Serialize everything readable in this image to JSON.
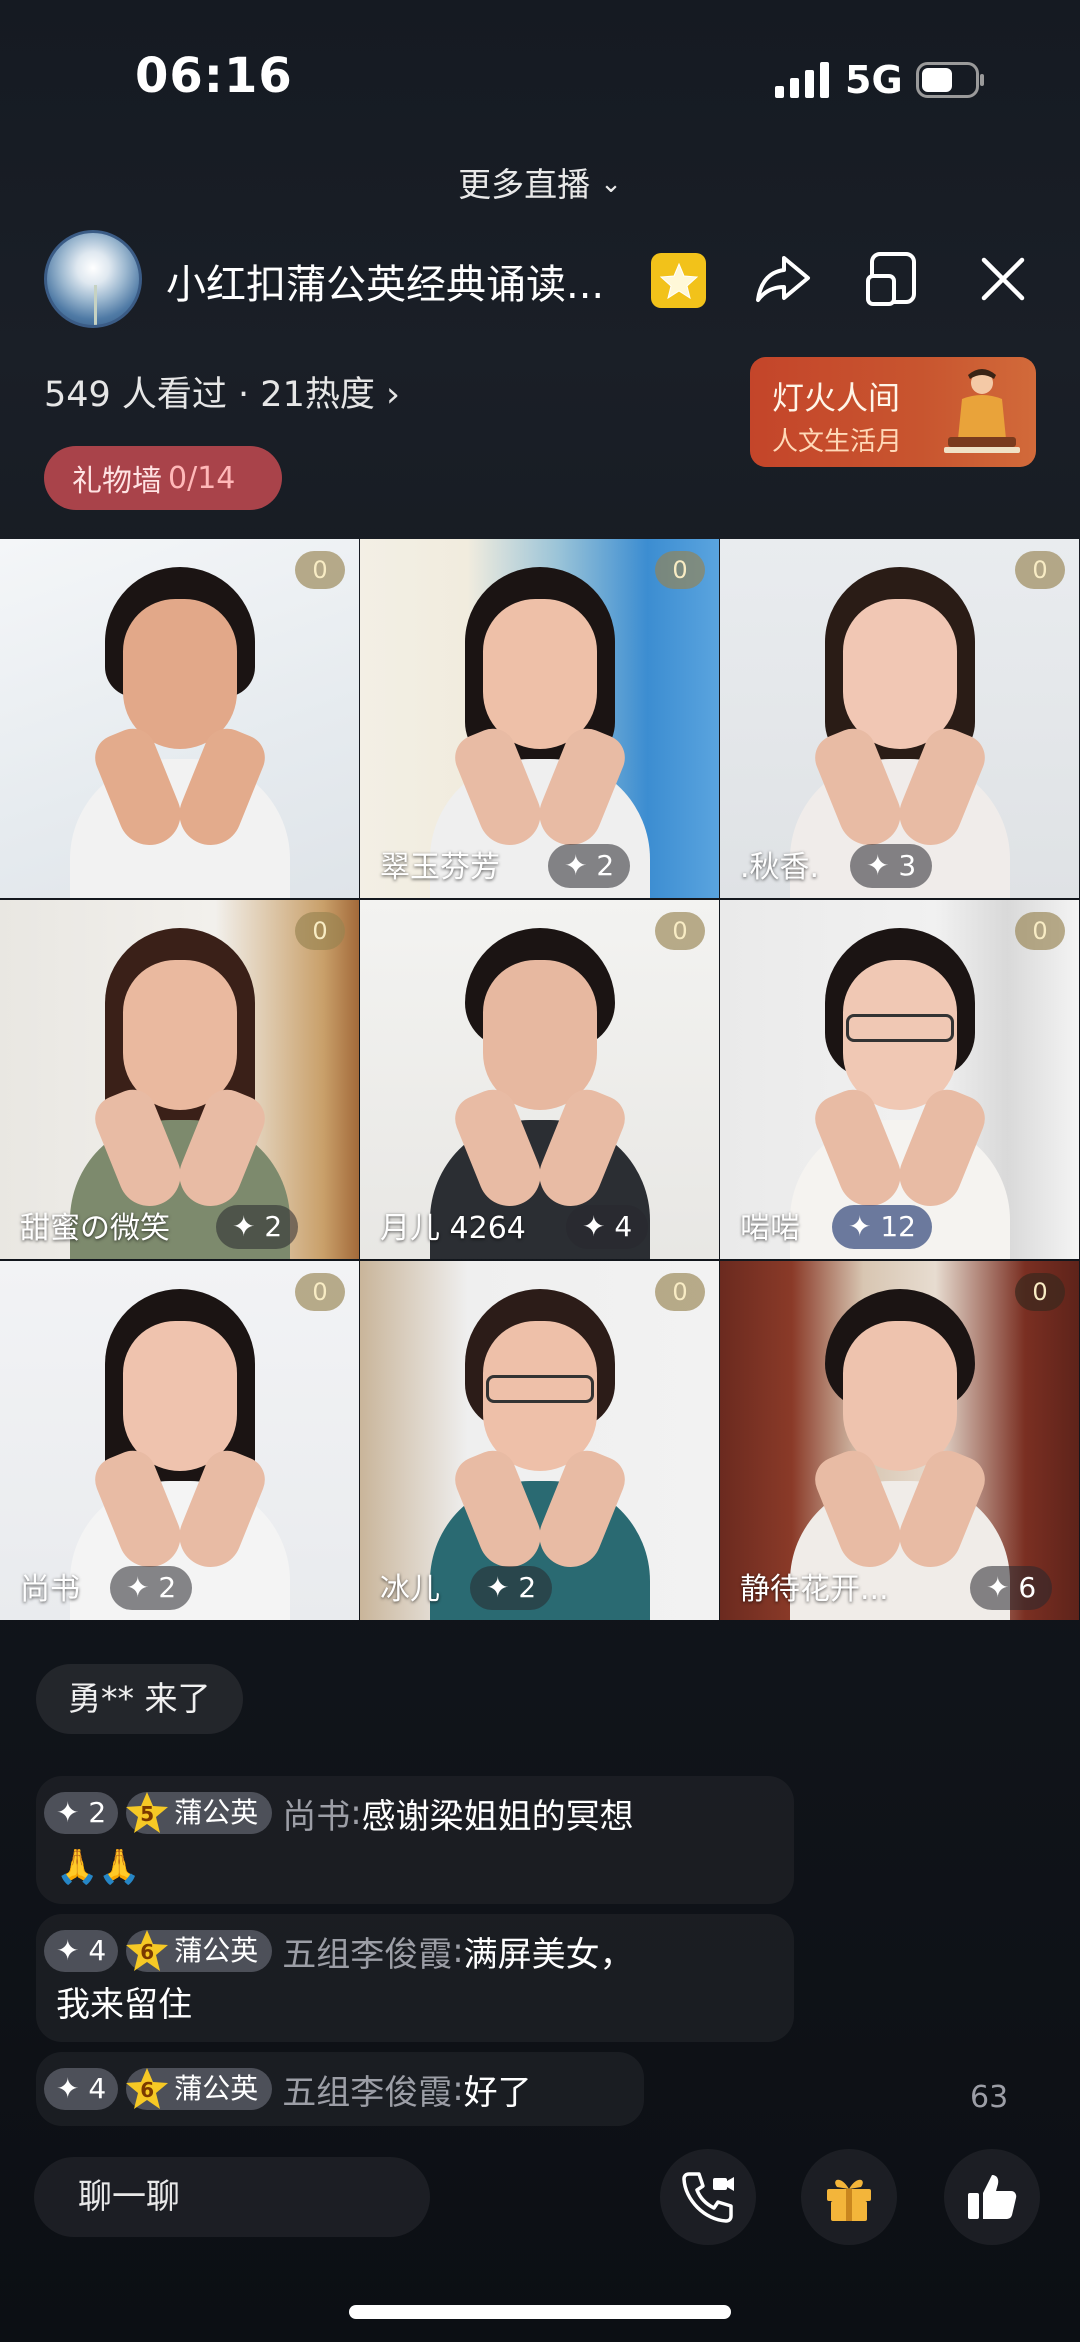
{
  "status_bar": {
    "time": "06:16",
    "network": "5G"
  },
  "more_live": {
    "label": "更多直播"
  },
  "header": {
    "title": "小红扣蒲公英经典诵读...",
    "stats": "549 人看过 · 21热度",
    "gift_wall_label": "礼物墙",
    "gift_wall_count": "0/14",
    "promo_title": "灯火人间",
    "promo_subtitle": "人文生活月"
  },
  "tiles": [
    {
      "badge": "0",
      "name": "",
      "score": ""
    },
    {
      "badge": "0",
      "name": "翠玉芬芳",
      "score": "✦ 2"
    },
    {
      "badge": "0",
      "name": ".秋香.",
      "score": "✦ 3"
    },
    {
      "badge": "0",
      "name": "甜蜜の微笑",
      "score": "✦ 2"
    },
    {
      "badge": "0",
      "name": "月儿 4264",
      "score": "✦ 4"
    },
    {
      "badge": "0",
      "name": "啱啱",
      "score": "✦ 12"
    },
    {
      "badge": "0",
      "name": "尚书",
      "score": "✦ 2"
    },
    {
      "badge": "0",
      "name": "冰儿",
      "score": "✦ 2"
    },
    {
      "badge": "0",
      "name": "静待花开...",
      "score": "✦ 6"
    }
  ],
  "chat": {
    "join": "勇** 来了",
    "messages": [
      {
        "points": "✦ 2",
        "level": "5",
        "fan_club": "蒲公英",
        "user": "尚书",
        "text": "感谢梁姐姐的冥想",
        "cont": "🙏🙏"
      },
      {
        "points": "✦ 4",
        "level": "6",
        "fan_club": "蒲公英",
        "user": "五组李俊霞",
        "text": "满屏美女，",
        "cont": "我来留住"
      },
      {
        "points": "✦ 4",
        "level": "6",
        "fan_club": "蒲公英",
        "user": "五组李俊霞",
        "text": "好了",
        "cont": ""
      }
    ]
  },
  "viewer_count": "63",
  "bottom": {
    "chat_placeholder": "聊一聊"
  },
  "colors": {
    "accent_gold": "#f2c21a",
    "promo_red": "#c4452a",
    "gift_wall": "#a9434a"
  }
}
